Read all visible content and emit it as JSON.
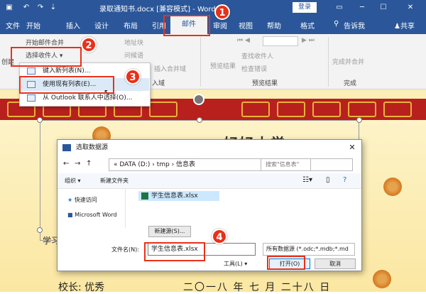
{
  "window": {
    "title": "录取通知书.docx [兼容模式] - Word",
    "login_label": "登录",
    "share_label": "共享",
    "tell_me": "告诉我"
  },
  "tabs": [
    "文件",
    "开始",
    "插入",
    "设计",
    "布局",
    "引用",
    "邮件",
    "审阅",
    "视图",
    "帮助",
    "格式"
  ],
  "ribbon": {
    "create_label": "创建",
    "start_merge": "开始邮件合并",
    "select_recipients": "选择收件人",
    "edit_list": "编辑收件人列表",
    "highlight": "突出显示",
    "address_block": "地址块",
    "greeting": "问候语",
    "insert_field": "插入合并域",
    "fields_group": "入域",
    "rules": "规则",
    "match": "匹配域",
    "update": "更新标签",
    "preview": "预览结果",
    "find_recipient": "查找收件人",
    "check_errors": "检查错误",
    "preview_group": "预览结果",
    "finish_merge": "完成并合并",
    "finish_group": "完成"
  },
  "menu": {
    "items": [
      {
        "label": "键入新列表(N)..."
      },
      {
        "label": "使用现有列表(E)..."
      },
      {
        "label": "从 Outlook 联系人中选择(O)..."
      }
    ]
  },
  "document": {
    "title": "好好大学",
    "side_text": "学习",
    "bottom_left": "校长: 优秀",
    "bottom_date": "二〇一八 年 七 月 二十八 日"
  },
  "dialog": {
    "title": "选取数据源",
    "address": "« DATA (D:) › tmp › 信息表",
    "search_placeholder": "搜索\"信息表\"",
    "organize": "组织 ▾",
    "new_folder": "新建文件夹",
    "nav_items": [
      "快速访问",
      "Microsoft Word"
    ],
    "file_name": "学生信息表.xlsx",
    "new_source": "新建源(S)...",
    "filename_label": "文件名(N):",
    "filename_value": "学生信息表.xlsx",
    "filetype": "所有数据源 (*.odc;*.mdb;*.md",
    "tools": "工具(L)  ▾",
    "open": "打开(O)",
    "cancel": "取消"
  },
  "callouts": [
    "1",
    "2",
    "3",
    "4"
  ],
  "colors": {
    "accent": "#2b579a",
    "callout": "#e8311a",
    "band": "#b8201d"
  }
}
